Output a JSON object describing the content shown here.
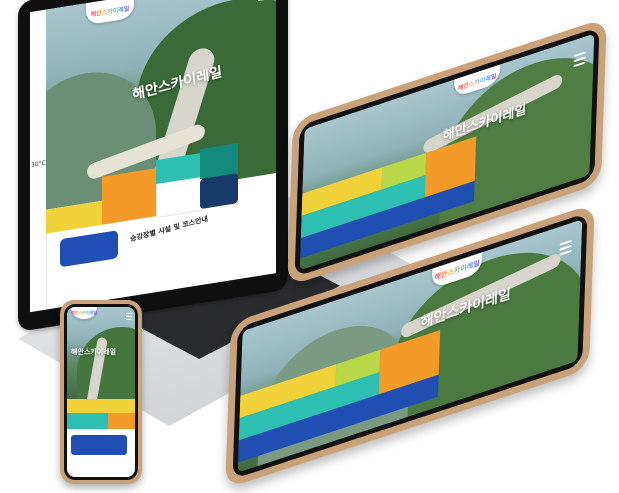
{
  "site": {
    "hero_title": "해안스카이레일",
    "logo_text": "해안스카이레일",
    "laptop_subtitle": "승강장별 시설 및 코스안내",
    "laptop_sidebar_label": "30°C",
    "tiles": {
      "yellow": "",
      "teal": "",
      "orange": "",
      "blue_booking": "",
      "dark_teal": "",
      "navy": ""
    }
  },
  "colors": {
    "yellow": "#f2d23b",
    "teal": "#2dbfb1",
    "orange": "#f39a28",
    "blue": "#1f4fb3",
    "dark_teal": "#138a7e",
    "navy": "#173a6a",
    "lime": "#b8d847"
  }
}
